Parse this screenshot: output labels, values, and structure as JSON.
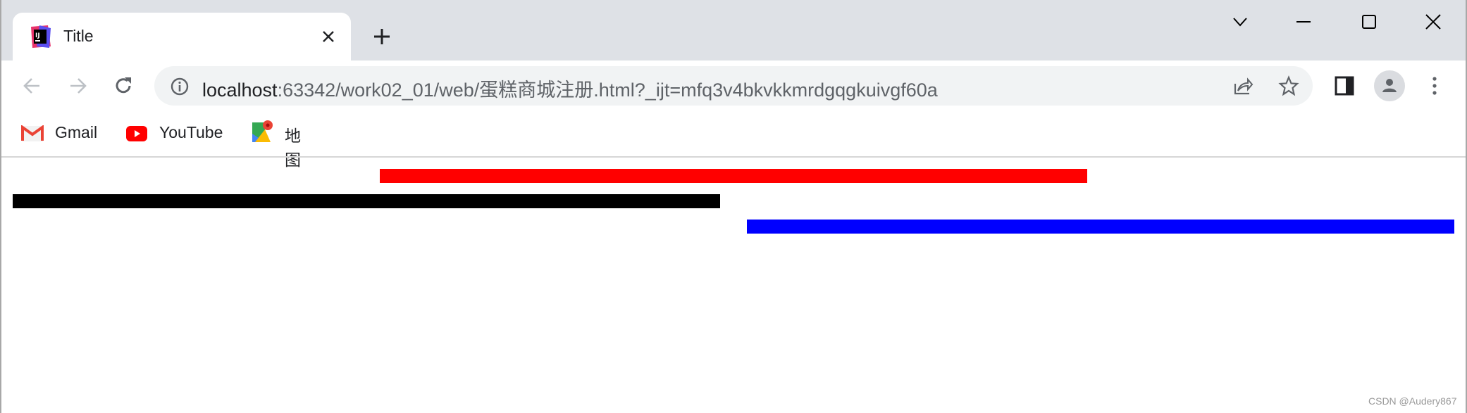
{
  "tab": {
    "title": "Title",
    "favicon": "intellij-icon"
  },
  "window_controls": [
    "chevron-down-icon",
    "minimize-icon",
    "maximize-icon",
    "close-icon"
  ],
  "address_bar": {
    "host": "localhost",
    "rest": ":63342/work02_01/web/蛋糕商城注册.html?_ijt=mfq3v4bkvkkmrdgqgkuivgf60a"
  },
  "bookmarks": [
    {
      "label": "Gmail",
      "icon": "gmail-icon"
    },
    {
      "label": "YouTube",
      "icon": "youtube-icon"
    },
    {
      "label": "地图",
      "icon": "maps-icon"
    }
  ],
  "content": {
    "bars": [
      {
        "name": "red-bar",
        "color": "#ff0000"
      },
      {
        "name": "black-bar",
        "color": "#000000"
      },
      {
        "name": "blue-bar",
        "color": "#0000ff"
      }
    ]
  },
  "watermark": "CSDN @Audery867"
}
